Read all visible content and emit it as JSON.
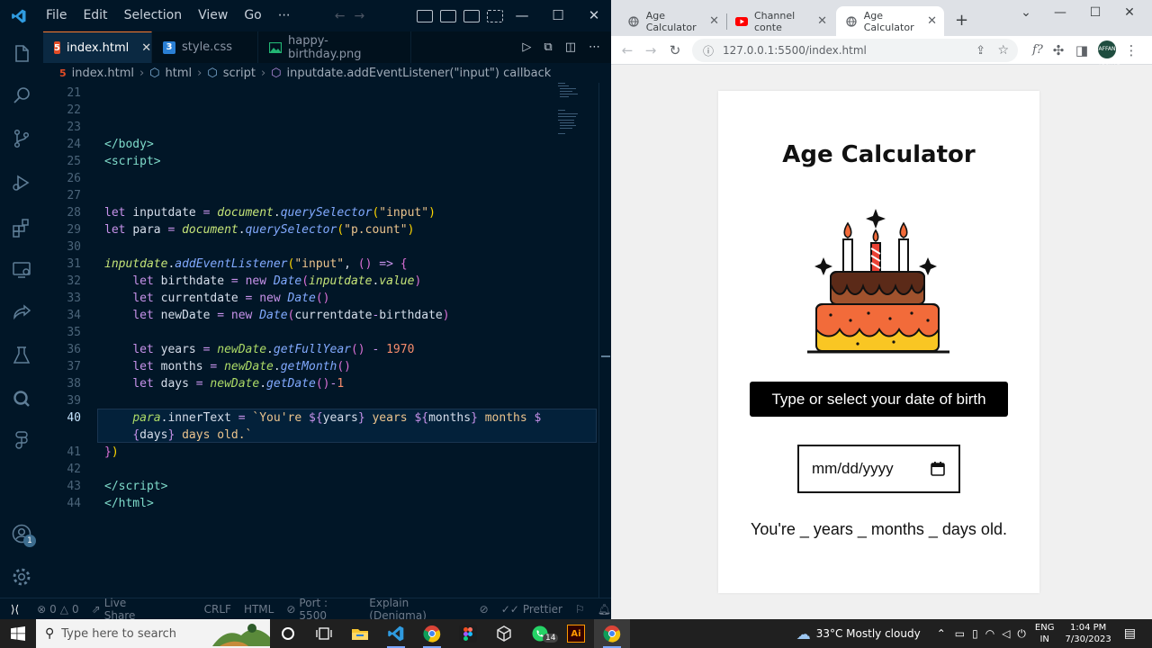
{
  "vscode": {
    "menu": [
      "File",
      "Edit",
      "Selection",
      "View",
      "Go",
      "⋯"
    ],
    "tabs": [
      {
        "label": "index.html",
        "icon": "html5-icon",
        "active": true
      },
      {
        "label": "style.css",
        "icon": "css3-icon",
        "active": false
      },
      {
        "label": "happy-birthday.png",
        "icon": "image-icon",
        "active": false
      }
    ],
    "breadcrumb": [
      "index.html",
      "html",
      "script",
      "inputdate.addEventListener(\"input\") callback"
    ],
    "line_numbers": [
      "21",
      "22",
      "23",
      "24",
      "25",
      "26",
      "27",
      "28",
      "29",
      "30",
      "31",
      "32",
      "33",
      "34",
      "35",
      "36",
      "37",
      "38",
      "39",
      "40",
      "",
      "41",
      "42",
      "43",
      "44"
    ],
    "current_line": "40",
    "statusbar": {
      "problems": "0",
      "warnings": "0",
      "live_share": "Live Share",
      "eol": "CRLF",
      "language": "HTML",
      "port": "Port : 5500",
      "explain": "Explain (Denigma)",
      "prettier": "Prettier"
    },
    "accounts_badge": "1"
  },
  "chrome": {
    "tabs": [
      {
        "label": "Age Calculator",
        "icon": "globe-icon",
        "active": false
      },
      {
        "label": "Channel conte",
        "icon": "youtube-icon",
        "active": false
      },
      {
        "label": "Age Calculator",
        "icon": "globe-icon",
        "active": true
      }
    ],
    "url": "127.0.0.1:5500/index.html",
    "profile_label": "AFFAN ARSHAD"
  },
  "app": {
    "title": "Age Calculator",
    "hint": "Type or select your date of birth",
    "date_placeholder": "mm/dd/yyyy",
    "result": "You're _ years _ months _ days old."
  },
  "taskbar": {
    "search_placeholder": "Type here to search",
    "whatsapp_badge": "14",
    "weather": "33°C  Mostly cloudy",
    "lang": "ENG",
    "region": "IN",
    "time": "1:04 PM",
    "date": "7/30/2023"
  }
}
